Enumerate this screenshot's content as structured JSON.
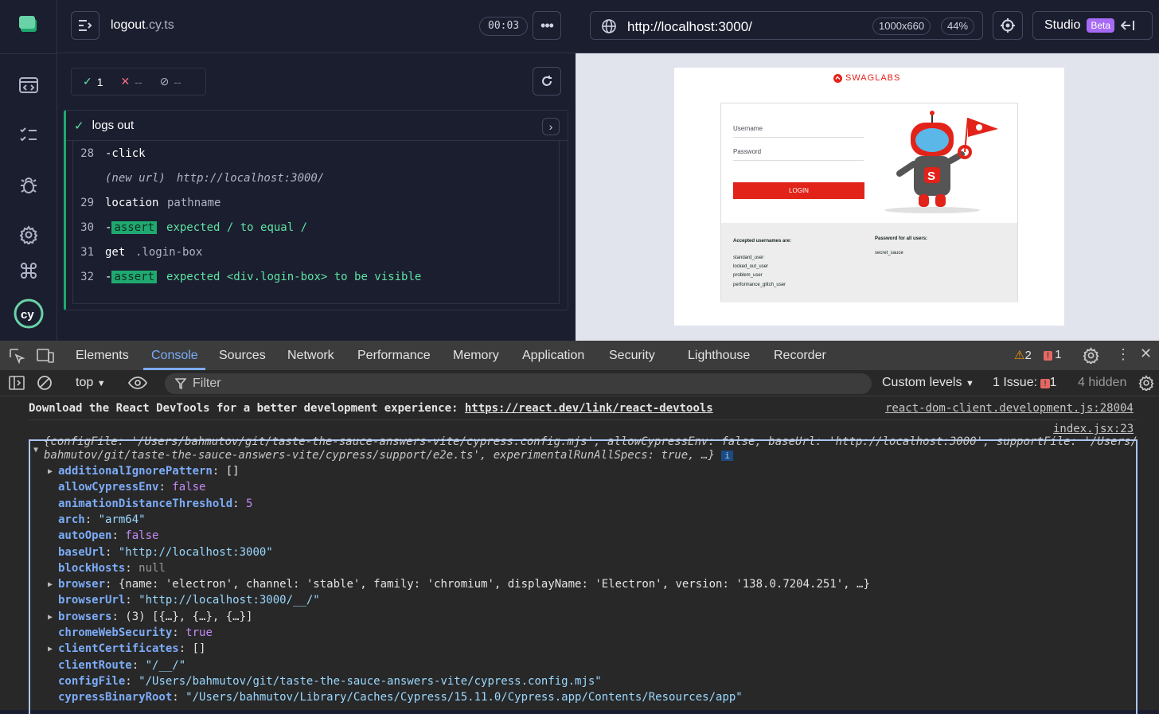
{
  "runner": {
    "spec_file_base": "logout",
    "spec_file_ext": ".cy.ts",
    "timer": "00:03",
    "stats": {
      "passed": "1",
      "failed": "--",
      "pending": "--"
    },
    "test_title": "logs out",
    "commands": [
      {
        "num": "28",
        "name": "-click",
        "arg": ""
      },
      {
        "num": "",
        "name": "(new url)",
        "arg": "http://localhost:3000/"
      },
      {
        "num": "29",
        "name": "location",
        "arg": "pathname"
      },
      {
        "num": "30",
        "name": "assert",
        "arg": "expected / to equal /"
      },
      {
        "num": "31",
        "name": "get",
        "arg": ".login-box"
      },
      {
        "num": "32",
        "name": "assert",
        "arg": "expected <div.login-box> to be visible"
      }
    ]
  },
  "aut_header": {
    "url": "http://localhost:3000/",
    "viewport": "1000x660",
    "zoom": "44%",
    "studio_label": "Studio",
    "beta_label": "Beta"
  },
  "aut_preview": {
    "brand": "SWAGLABS",
    "username_placeholder": "Username",
    "password_placeholder": "Password",
    "login_button": "LOGIN",
    "accepted_heading": "Accepted usernames are:",
    "usernames": [
      "standard_user",
      "locked_out_user",
      "problem_user",
      "performance_glitch_user"
    ],
    "password_heading": "Password for all users:",
    "password_value": "secret_sauce"
  },
  "devtools": {
    "tabs": [
      "Elements",
      "Console",
      "Sources",
      "Network",
      "Performance",
      "Memory",
      "Application",
      "Security",
      "Lighthouse",
      "Recorder"
    ],
    "warnings_count": "2",
    "errors_count": "1",
    "context": "top",
    "filter_placeholder": "Filter",
    "levels": "Custom levels",
    "issues_label": "1 Issue:",
    "issues_count": "1",
    "hidden": "4 hidden",
    "react_message": "Download the React DevTools for a better development experience:",
    "react_link": "https://react.dev/link/react-devtools",
    "react_source": "react-dom-client.development.js:28004",
    "log_source": "index.jsx:23",
    "summary_line1": "{configFile: '/Users/bahmutov/git/taste-the-sauce-answers-vite/cypress.config.mjs', allowCypressEnv: false, baseUrl: 'http://localhost:3000', supportFile: '/Users/",
    "summary_line2": "bahmutov/git/taste-the-sauce-answers-vite/cypress/support/e2e.ts', experimentalRunAllSpecs: true, …}",
    "props": [
      {
        "key": "additionalIgnorePattern",
        "value": "[]",
        "type": "plain",
        "expandable": true
      },
      {
        "key": "allowCypressEnv",
        "value": "false",
        "type": "bool",
        "expandable": false
      },
      {
        "key": "animationDistanceThreshold",
        "value": "5",
        "type": "bool",
        "expandable": false
      },
      {
        "key": "arch",
        "value": "\"arm64\"",
        "type": "str",
        "expandable": false
      },
      {
        "key": "autoOpen",
        "value": "false",
        "type": "bool",
        "expandable": false
      },
      {
        "key": "baseUrl",
        "value": "\"http://localhost:3000\"",
        "type": "str",
        "expandable": false
      },
      {
        "key": "blockHosts",
        "value": "null",
        "type": "null",
        "expandable": false
      },
      {
        "key": "browser",
        "value": "{name: 'electron', channel: 'stable', family: 'chromium', displayName: 'Electron', version: '138.0.7204.251', …}",
        "type": "plain",
        "expandable": true
      },
      {
        "key": "browserUrl",
        "value": "\"http://localhost:3000/__/\"",
        "type": "str",
        "expandable": false
      },
      {
        "key": "browsers",
        "value": "(3) [{…}, {…}, {…}]",
        "type": "plain",
        "expandable": true
      },
      {
        "key": "chromeWebSecurity",
        "value": "true",
        "type": "bool",
        "expandable": false
      },
      {
        "key": "clientCertificates",
        "value": "[]",
        "type": "plain",
        "expandable": true
      },
      {
        "key": "clientRoute",
        "value": "\"/__/\"",
        "type": "str",
        "expandable": false
      },
      {
        "key": "configFile",
        "value": "\"/Users/bahmutov/git/taste-the-sauce-answers-vite/cypress.config.mjs\"",
        "type": "str",
        "expandable": false
      },
      {
        "key": "cypressBinaryRoot",
        "value": "\"/Users/bahmutov/Library/Caches/Cypress/15.11.0/Cypress.app/Contents/Resources/app\"",
        "type": "str",
        "expandable": false
      }
    ]
  }
}
